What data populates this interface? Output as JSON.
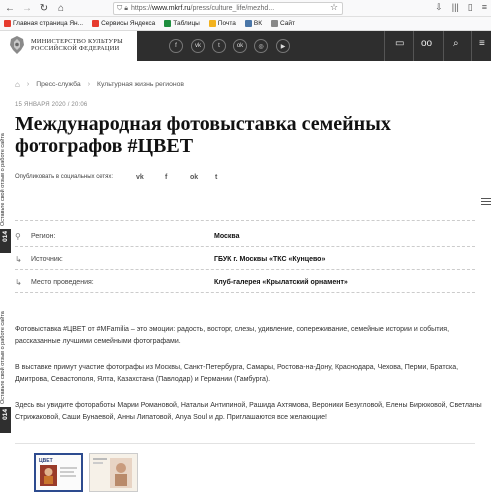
{
  "browser": {
    "url_host": "www.mkrf.ru",
    "url_path": "/press/culture_life/mezhd...",
    "url_prefix": "https://",
    "bookmarks": [
      {
        "label": "Главная страница Ян...",
        "color": "#e63b2e"
      },
      {
        "label": "Сервисы Яндекса",
        "color": "#e63b2e"
      },
      {
        "label": "Таблицы",
        "color": "#1e8e3e"
      },
      {
        "label": "Почта",
        "color": "#f2b21f"
      },
      {
        "label": "ВК",
        "color": "#4a76a8"
      },
      {
        "label": "Сайт",
        "color": "#888888"
      }
    ]
  },
  "header": {
    "logo_line1": "МИНИСТЕРСТВО КУЛЬТУРЫ",
    "logo_line2": "РОССИЙСКОЙ ФЕДЕРАЦИИ",
    "socials": [
      "f",
      "vk",
      "tw",
      "ok",
      "ig",
      "yt"
    ]
  },
  "breadcrumb": {
    "items": [
      "Пресс-служба",
      "Культурная жизнь регионов"
    ]
  },
  "article": {
    "date": "15 ЯНВАРЯ 2020 / 20:06",
    "title": "Международная фотовыставка семейных фотографов #ЦВЕТ",
    "share_label": "Опубликовать в социальных сетях:",
    "share_icons": [
      "vk",
      "f",
      "ok",
      "tw"
    ],
    "info": [
      {
        "label": "Регион:",
        "value": "Москва",
        "icon": "map-marker-icon"
      },
      {
        "label": "Источник:",
        "value": "ГБУК г. Москвы «ТКС «Кунцево»",
        "icon": "source-arrow-icon"
      },
      {
        "label": "Место проведения:",
        "value": "Клуб-галерея «Крылатский орнамент»",
        "icon": "venue-arrow-icon"
      }
    ],
    "paragraphs": [
      "Фотовыставка #ЦВЕТ от #MFamilia – это эмоции: радость, восторг, слезы, удивление, сопереживание, семейные истории и события, рассказанные лучшими семейными фотографами.",
      "В выставке примут участие фотографы из Москвы, Санкт-Петербурга, Самары, Ростова-на-Дону, Краснодара, Чехова, Перми, Братска, Дмитрова, Севастополя, Ялта, Казахстана (Павлодар) и Германии (Гамбурга).",
      "Здесь вы увидите фотоработы Марии Романовой, Натальи Антипиной, Рашида Ахтямова, Вероники Безугловой, Елены Бирюковой, Светланы Стрижаковой, Саши Бунаевой, Анны Липатовой, Anya Soul и др. Приглашаются все желающие!"
    ]
  },
  "feedback": {
    "number": "014",
    "text": "Оставьте свой отзыв о работе сайта"
  },
  "gallery": {
    "thumb_title": "ЦВЕТ"
  }
}
